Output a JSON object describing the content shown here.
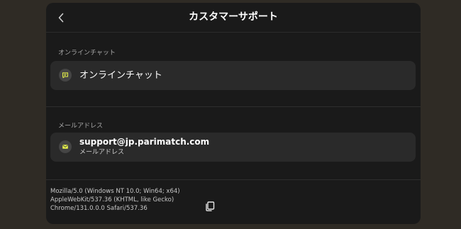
{
  "header": {
    "title": "カスタマーサポート",
    "back_icon": "chevron-left-icon"
  },
  "chat_section": {
    "label": "オンラインチャット",
    "card_label": "オンラインチャット",
    "icon": "chat-bubble-icon"
  },
  "email_section": {
    "label": "メールアドレス",
    "email": "support@jp.parimatch.com",
    "sub_label": "メールアドレス",
    "icon": "envelope-icon"
  },
  "user_agent": {
    "lines": [
      "Mozilla/5.0 (Windows NT 10.0; Win64; x64)",
      "AppleWebKit/537.36 (KHTML, like Gecko)",
      "Chrome/131.0.0.0 Safari/537.36"
    ],
    "copy_icon": "copy-icon"
  },
  "colors": {
    "background": "#2f2b25",
    "panel": "#1a1a1a",
    "card": "#2a2a2a",
    "accent": "#e6f24a"
  }
}
